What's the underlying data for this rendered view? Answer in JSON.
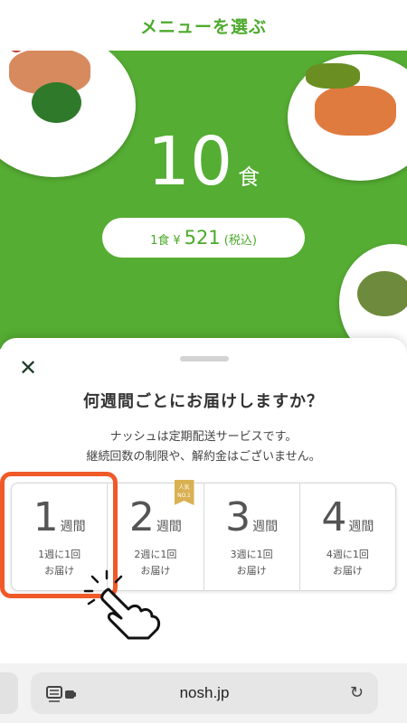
{
  "header": {
    "title": "メニューを選ぶ"
  },
  "hero": {
    "count": "10",
    "count_unit": "食",
    "price": {
      "prefix": "1食",
      "currency": "¥",
      "amount": "521",
      "tax_note": "(税込)"
    }
  },
  "sheet": {
    "title": "何週間ごとにお届けしますか？",
    "desc_line1": "ナッシュは定期配送サービスです。",
    "desc_line2": "継続回数の制限や、解約金はございません。",
    "options": [
      {
        "num": "1",
        "unit": "週間",
        "line1": "1週に1回",
        "line2": "お届け"
      },
      {
        "num": "2",
        "unit": "週間",
        "line1": "2週に1回",
        "line2": "お届け",
        "badge_line1": "人気",
        "badge_line2": "NO.1"
      },
      {
        "num": "3",
        "unit": "週間",
        "line1": "3週に1回",
        "line2": "お届け"
      },
      {
        "num": "4",
        "unit": "週間",
        "line1": "4週に1回",
        "line2": "お届け"
      }
    ]
  },
  "browser": {
    "url": "nosh.jp"
  },
  "colors": {
    "brand_green": "#55ad33",
    "highlight": "#f05a28",
    "badge_gold": "#d9b153"
  },
  "icons": {
    "close": "close-icon",
    "reader": "reader-icon",
    "reload": "reload-icon",
    "hand": "tap-hand-icon"
  }
}
